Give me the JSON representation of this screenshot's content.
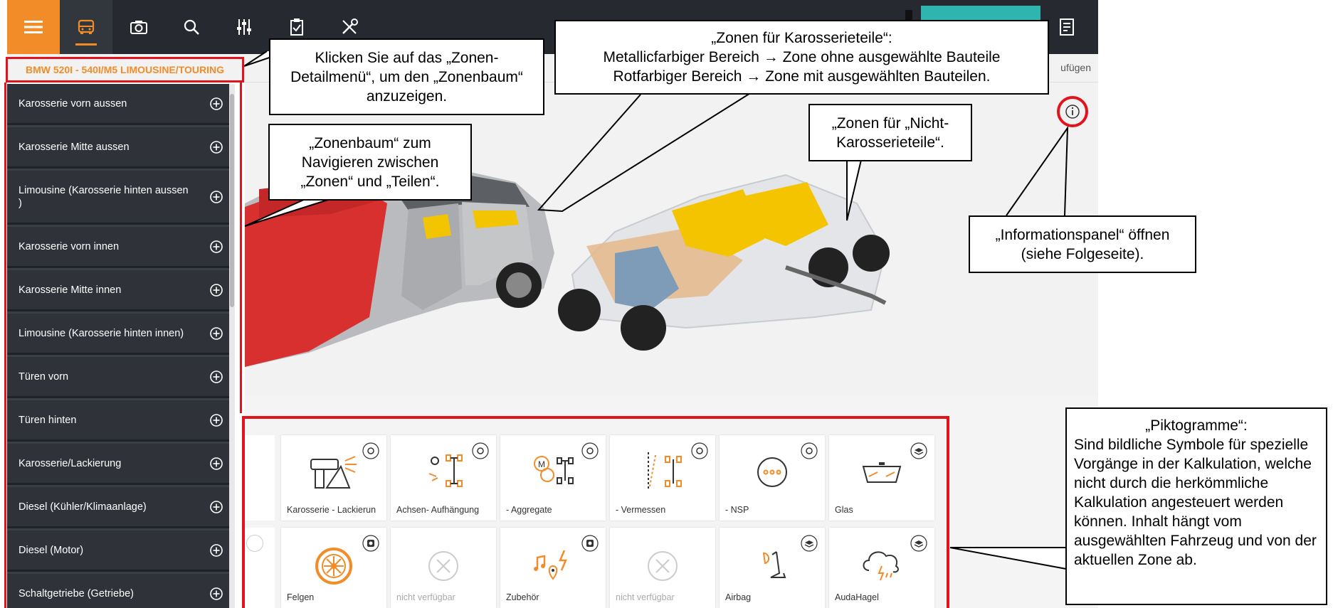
{
  "header": {
    "vehicle_title": "BMW 520I - 540I/M5 LIMOUSINE/TOURING",
    "subbar_right": "ufügen"
  },
  "sidebar": {
    "items": [
      {
        "label": "Karosserie vorn aussen"
      },
      {
        "label": "Karosserie Mitte aussen"
      },
      {
        "label": "Limousine (Karosserie hinten aussen )"
      },
      {
        "label": "Karosserie vorn innen"
      },
      {
        "label": "Karosserie Mitte innen"
      },
      {
        "label": "Limousine (Karosserie hinten innen)"
      },
      {
        "label": "Türen vorn"
      },
      {
        "label": "Türen hinten"
      },
      {
        "label": "Karosserie/Lackierung"
      },
      {
        "label": "Diesel (Kühler/Klimaanlage)"
      },
      {
        "label": "Diesel (Motor)"
      },
      {
        "label": "Schaltgetriebe (Getriebe)"
      }
    ]
  },
  "pictograms": {
    "row1": [
      {
        "label": "Karosserie - Lackierun",
        "icon": "paint-gun-icon",
        "badge": "gear-badge-icon"
      },
      {
        "label": "Achsen- Aufhängung",
        "icon": "axle-suspension-icon",
        "badge": "gear-badge-icon"
      },
      {
        "label": "- Aggregate",
        "icon": "aggregate-icon",
        "badge": "gear-badge-icon"
      },
      {
        "label": "- Vermessen",
        "icon": "alignment-icon",
        "badge": "gear-badge-icon"
      },
      {
        "label": "- NSP",
        "icon": "more-dots-icon",
        "badge": "gear-badge-icon"
      },
      {
        "label": "Glas",
        "icon": "windshield-icon",
        "badge": "layers-badge-icon"
      }
    ],
    "row2": [
      {
        "label": "Felgen",
        "icon": "rim-icon",
        "badge": "module-badge-icon"
      },
      {
        "label": "nicht verfügbar",
        "icon": "unavailable-icon",
        "badge": ""
      },
      {
        "label": "Zubehör",
        "icon": "accessories-icon",
        "badge": "module-badge-icon"
      },
      {
        "label": "nicht verfügbar",
        "icon": "unavailable-icon",
        "badge": ""
      },
      {
        "label": "Airbag",
        "icon": "airbag-seat-icon",
        "badge": "layers-badge-icon"
      },
      {
        "label": "AudaHagel",
        "icon": "hail-cloud-icon",
        "badge": "layers-badge-icon"
      }
    ]
  },
  "callouts": {
    "zone_detail": "Klicken Sie auf das „Zonen-Detailmenü“, um den „Zonenbaum“ anzuzeigen.",
    "zonenbaum": "„Zonenbaum“ zum Navigieren zwischen „Zonen“ und „Teilen“.",
    "karosserie_title": "„Zonen für Karosserieteile“:",
    "karosserie_line1": "Metallicfarbiger Bereich → Zone ohne ausgewählte Bauteile",
    "karosserie_line2": "Rotfarbiger Bereich → Zone mit ausgewählten Bauteilen.",
    "nicht_karosserie": "„Zonen für „Nicht-Karosserieteile“.",
    "info_panel": "„Informationspanel“ öffnen (siehe Folgeseite).",
    "piktogramme_title": "„Piktogramme“:",
    "piktogramme_body": "Sind bildliche Symbole für spezielle Vorgänge in der Kalkulation, welche nicht durch die herkömmliche Kalkulation angesteuert werden können. Inhalt hängt vom ausgewählten Fahrzeug und von der aktuellen Zone ab."
  },
  "colors": {
    "accent_orange": "#f28c28",
    "highlight_red": "#e1141e",
    "dark_bar": "#262a30",
    "teal": "#2fb5b0"
  }
}
